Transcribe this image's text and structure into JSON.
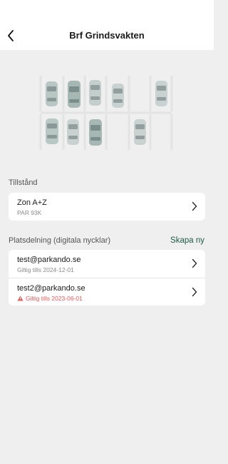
{
  "header": {
    "title": "Brf Grindsvakten"
  },
  "permits": {
    "section_label": "Tillstånd",
    "items": [
      {
        "title": "Zon A+Z",
        "subtitle": "PAR 93K"
      }
    ]
  },
  "sharing": {
    "section_label": "Platsdelning (digitala nycklar)",
    "create_label": "Skapa ny",
    "items": [
      {
        "email": "test@parkando.se",
        "validity": "Giltig tills 2024-12-01",
        "expired": false
      },
      {
        "email": "test2@parkando.se",
        "validity": "Giltig tills 2023-06-01",
        "expired": true
      }
    ]
  },
  "colors": {
    "accent": "#1f5b45",
    "warning": "#e05a5a",
    "background": "#efefef"
  },
  "icons": {
    "back": "chevron-left-icon",
    "row": "chevron-right-icon",
    "warning": "warning-triangle-icon",
    "illustration": "parking-lot-icon"
  }
}
